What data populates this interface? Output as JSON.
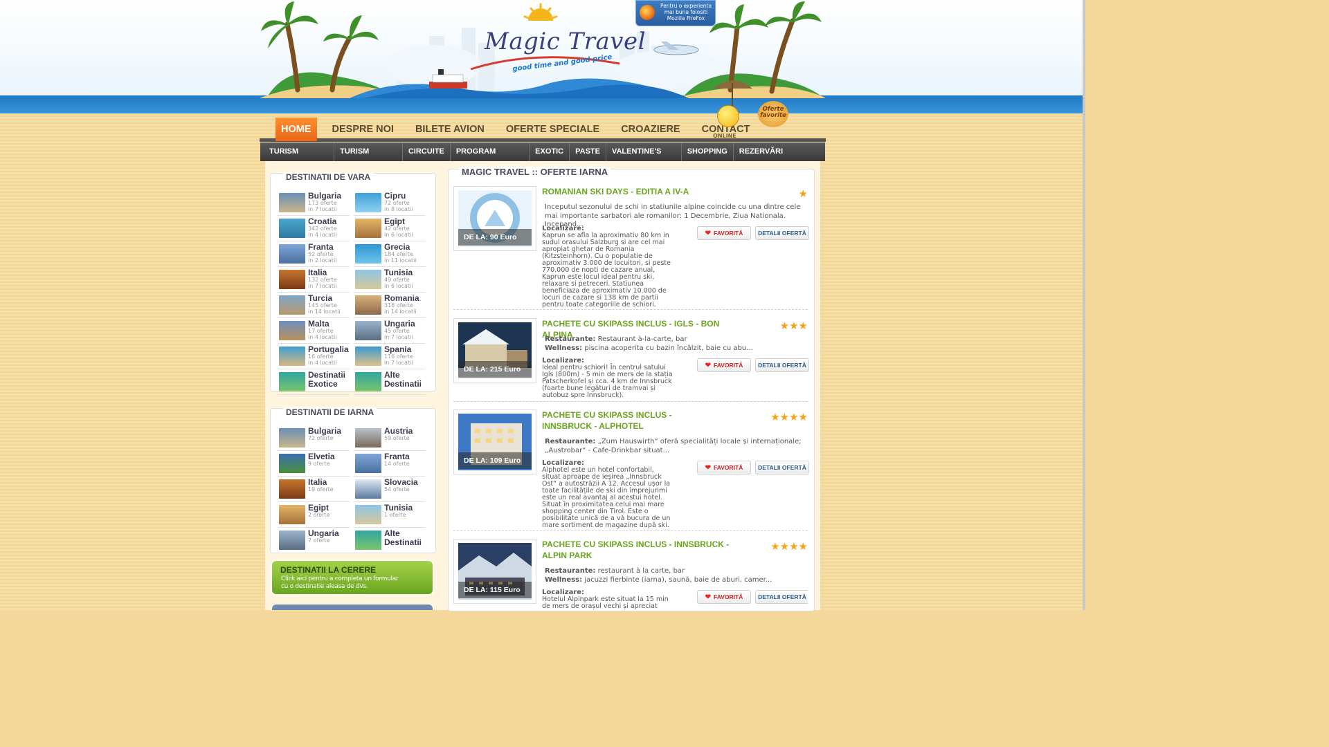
{
  "header": {
    "logo_title": "Magic Travel",
    "logo_tagline": "good time and good price",
    "browser_badge": "Pentru o experienta mai buna folositi Mozilla FireFox",
    "online_label": "ONLINE",
    "favorites_badge": "Oferte favorite"
  },
  "main_nav": [
    {
      "label": "HOME",
      "active": true
    },
    {
      "label": "DESPRE NOI",
      "active": false
    },
    {
      "label": "BILETE AVION",
      "active": false
    },
    {
      "label": "OFERTE SPECIALE",
      "active": false
    },
    {
      "label": "CROAZIERE",
      "active": false
    },
    {
      "label": "CONTACT",
      "active": false
    }
  ],
  "sub_nav": [
    "TURISM EXTERN",
    "TURISM INTERN",
    "CIRCUITE",
    "PROGRAM SENIOR",
    "EXOTIC",
    "PASTE",
    "VALENTINE'S DAY",
    "SHOPPING",
    "REZERVĂRI HOTELURI"
  ],
  "summer": {
    "title": "DESTINATII DE VARA",
    "items": [
      {
        "name": "Bulgaria",
        "offers": "173 oferte",
        "locations": "in 7 locatii"
      },
      {
        "name": "Cipru",
        "offers": "72 oferte",
        "locations": "in 8 locatii"
      },
      {
        "name": "Croatia",
        "offers": "342 oferte",
        "locations": "in 4 locatii"
      },
      {
        "name": "Egipt",
        "offers": "42 oferte",
        "locations": "in 6 locatii"
      },
      {
        "name": "Franta",
        "offers": "52 oferte",
        "locations": "in 2 locatii"
      },
      {
        "name": "Grecia",
        "offers": "184 oferte",
        "locations": "in 11 locatii"
      },
      {
        "name": "Italia",
        "offers": "132 oferte",
        "locations": "in 7 locatii"
      },
      {
        "name": "Tunisia",
        "offers": "49 oferte",
        "locations": "in 6 locatii"
      },
      {
        "name": "Turcia",
        "offers": "145 oferte",
        "locations": "in 14 locatii"
      },
      {
        "name": "Romania",
        "offers": "316 oferte",
        "locations": "in 14 locatii"
      },
      {
        "name": "Malta",
        "offers": "17 oferte",
        "locations": "in 4 locatii"
      },
      {
        "name": "Ungaria",
        "offers": "45 oferte",
        "locations": "in 7 locatii"
      },
      {
        "name": "Portugalia",
        "offers": "16 oferte",
        "locations": "in 4 locatii"
      },
      {
        "name": "Spania",
        "offers": "116 oferte",
        "locations": "in 7 locatii"
      }
    ],
    "extra": [
      {
        "line1": "Destinatii",
        "line2": "Exotice"
      },
      {
        "line1": "Alte",
        "line2": "Destinatii"
      }
    ]
  },
  "winter": {
    "title": "DESTINATII DE IARNA",
    "items": [
      {
        "name": "Bulgaria",
        "offers": "72 oferte"
      },
      {
        "name": "Austria",
        "offers": "59 oferte"
      },
      {
        "name": "Elvetia",
        "offers": "9 oferte"
      },
      {
        "name": "Franta",
        "offers": "14 oferte"
      },
      {
        "name": "Italia",
        "offers": "19 oferte"
      },
      {
        "name": "Slovacia",
        "offers": "54 oferte"
      },
      {
        "name": "Egipt",
        "offers": "2 oferte"
      },
      {
        "name": "Tunisia",
        "offers": "1 oferte"
      },
      {
        "name": "Ungaria",
        "offers": "7 oferte"
      }
    ],
    "extra": {
      "line1": "Alte",
      "line2": "Destinatii"
    }
  },
  "request_banner": {
    "title": "DESTINATII LA CERERE",
    "text_line1": "Click aici pentru a completa un formular",
    "text_line2": "cu o destinatie aleasa de dvs."
  },
  "offers_section": {
    "title": "MAGIC TRAVEL :: OFERTE IARNA",
    "favorite_label": "FAVORITĂ",
    "details_label": "DETALII OFERTĂ",
    "offers": [
      {
        "title": "ROMANIAN SKI DAYS - EDITIA A IV-A",
        "price": "DE LA: 90 Euro",
        "stars": 1,
        "desc": "Inceputul sezonului de schi in statiunile alpine coincide cu una dintre cele mai importante sarbatori ale romanilor: 1 Decembrie, Ziua Nationala. Incepand...",
        "location_label": "Localizare:",
        "location": "Kaprun se afla la aproximativ 80 km in sudul orasului Salzburg si are cel mai apropiat ghetar de Romania (Kitzsteinhorn). Cu o populatie de aproximativ 3.000 de locuitori, si peste 770.000 de nopti de cazare anual, Kaprun este locul ideal pentru ski, relaxare si petreceri. Statiunea beneficiaza de aproximativ 10.000 de locuri de cazare si 138 km de partii pentru toate categoriile de schiori."
      },
      {
        "title": "PACHETE CU SKIPASS INCLUS - IGLS - BON ALPINA",
        "price": "DE LA: 215 Euro",
        "stars": 3,
        "restaurant_label": "Restaurante:",
        "restaurant": "Restaurant à-la-carte, bar",
        "wellness_label": "Wellness:",
        "wellness": "piscina acoperita cu bazin încălzit, baie cu abu...",
        "location_label": "Localizare:",
        "location": "Ideal pentru schiori! În centrul satului Igls (800m) - 5 min de mers de la stația Patscherkofel și cca. 4 km de Innsbruck (foarte bune legături de tramvai și autobuz spre Innsbruck)."
      },
      {
        "title": "PACHETE CU SKIPASS INCLUS - INNSBRUCK - ALPHOTEL",
        "price": "DE LA: 109 Euro",
        "stars": 4,
        "restaurant_label": "Restaurante:",
        "restaurant": "„Zum Hauswirth“ oferă specialități locale și internaționale; „Austrobar“ - Cafe-Drinkbar situat...",
        "location_label": "Localizare:",
        "location": "Alphotel este un hotel confortabil, situat aproape de ieșirea „Innsbruck Ost“ a autostrăzii A 12. Accesul ușor la toate facilitățile de ski din împrejurimi este un real avantaj al acestui hotel. Situat în proximitatea celui mai mare shopping center din Tirol. Este o posibilitate unică de a vă bucura de un mare sortiment de magazine după ski."
      },
      {
        "title": "PACHETE CU SKIPASS INCLUS - INNSBRUCK - ALPIN PARK",
        "price": "DE LA: 115 Euro",
        "stars": 4,
        "restaurant_label": "Restaurante:",
        "restaurant": "restaurant à la carte, bar",
        "wellness_label": "Wellness:",
        "wellness": "jacuzzi fierbinte (iarna), saună, baie de aburi, camer...",
        "location_label": "Localizare:",
        "location": "Hotelul Alpinpark este situat la 15 min de mers de orașul vechi și apreciat pentru"
      }
    ]
  },
  "colors": {
    "nav_active": "#e8661a",
    "offer_title": "#6aa51f",
    "subnav_bg": "#3a3a3a",
    "sea": "#1f79c5",
    "sand": "#f6dea7",
    "star": "#f6a11a"
  }
}
